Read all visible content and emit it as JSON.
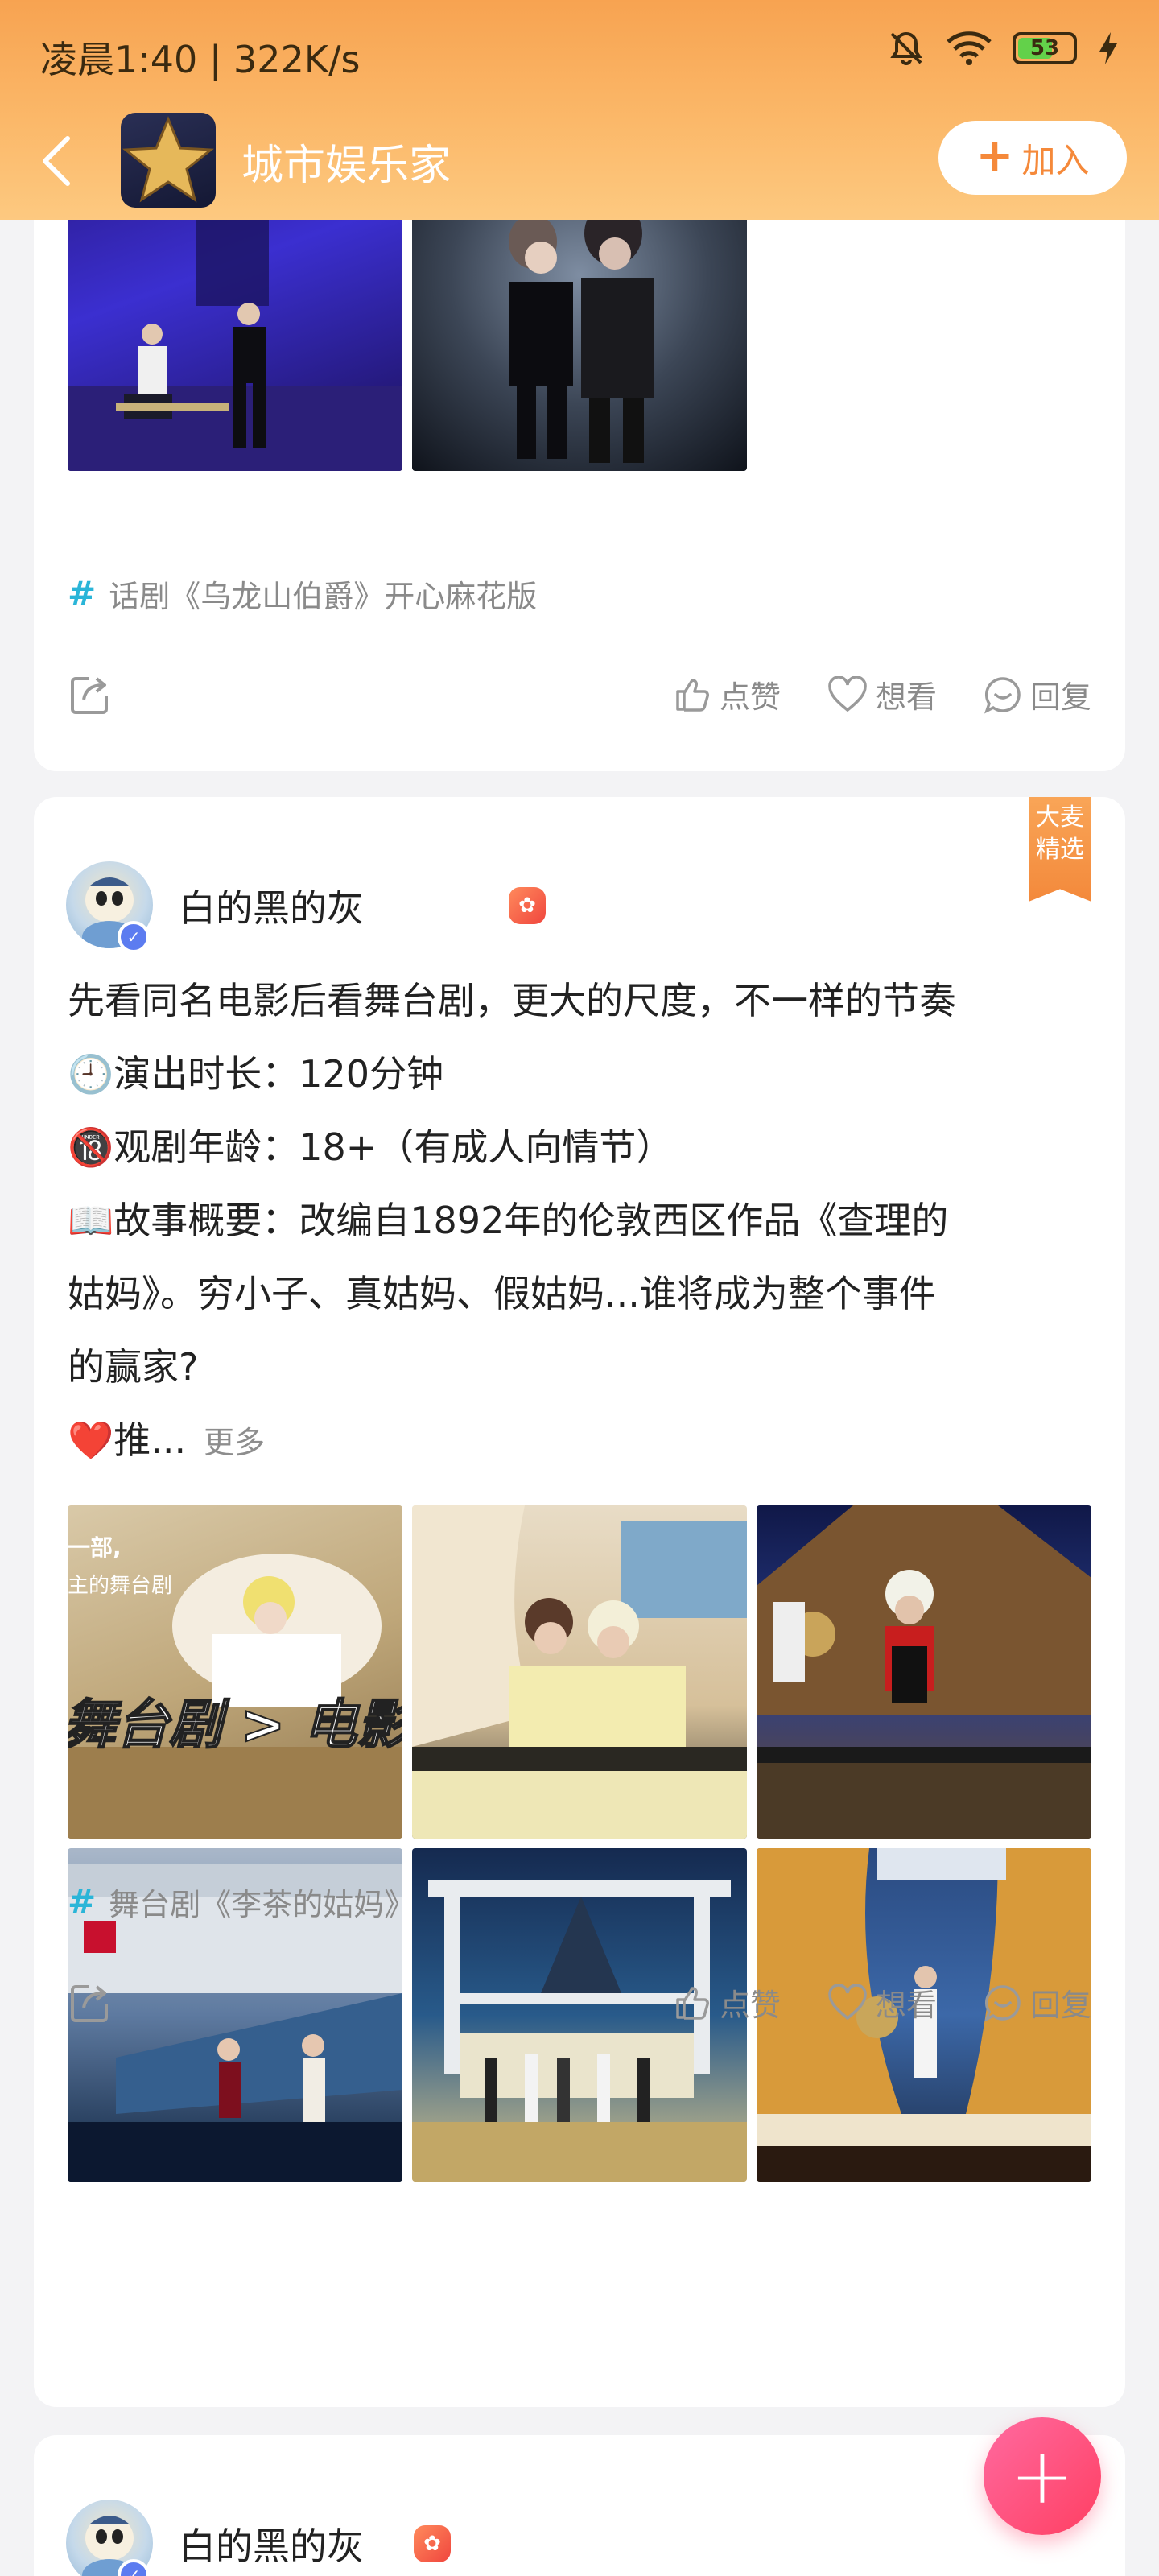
{
  "status_bar": {
    "time": "凌晨1:40 | 322K/s",
    "battery": "53"
  },
  "nav": {
    "title": "城市娱乐家",
    "join_label": "加入",
    "logo_text": "城市娱乐家"
  },
  "posts": [
    {
      "topic": "话剧《乌龙山伯爵》开心麻花版",
      "actions": {
        "like": "点赞",
        "want": "想看",
        "reply": "回复"
      }
    },
    {
      "author": "白的黑的灰",
      "ribbon": [
        "大麦",
        "精选"
      ],
      "text": {
        "line1": "先看同名电影后看舞台剧，更大的尺度，不一样的节奏",
        "line2": "🕘演出时长：120分钟",
        "line3": "🔞观剧年龄：18+（有成人向情节）",
        "line4": "📖故事概要：改编自1892年的伦敦西区作品《查理的",
        "line5": "姑妈》。穷小子、真姑妈、假姑妈...谁将成为整个事件",
        "line6": "的赢家?",
        "line7": "❤️推...",
        "more": "更多"
      },
      "image_text": {
        "top": "一部,",
        "sub": "主的舞台剧",
        "big": "舞台剧 > 电影"
      },
      "topic": "舞台剧《李茶的姑妈》",
      "actions": {
        "like": "点赞",
        "want": "想看",
        "reply": "回复"
      }
    },
    {
      "author": "白的黑的灰"
    }
  ],
  "colors": {
    "header_gradient_start": "#f7a351",
    "header_gradient_end": "#fdc980",
    "accent_orange": "#f5893a",
    "topic_hash": "#2ab5d8",
    "fab_pink": "#ff4f75"
  },
  "icons": [
    "back-arrow-icon",
    "bell-muted-icon",
    "wifi-icon",
    "battery-icon",
    "charging-icon",
    "plus-icon",
    "share-icon",
    "thumb-up-icon",
    "heart-icon",
    "reply-bubble-icon",
    "verified-icon",
    "flower-badge-icon",
    "add-fab-icon"
  ]
}
